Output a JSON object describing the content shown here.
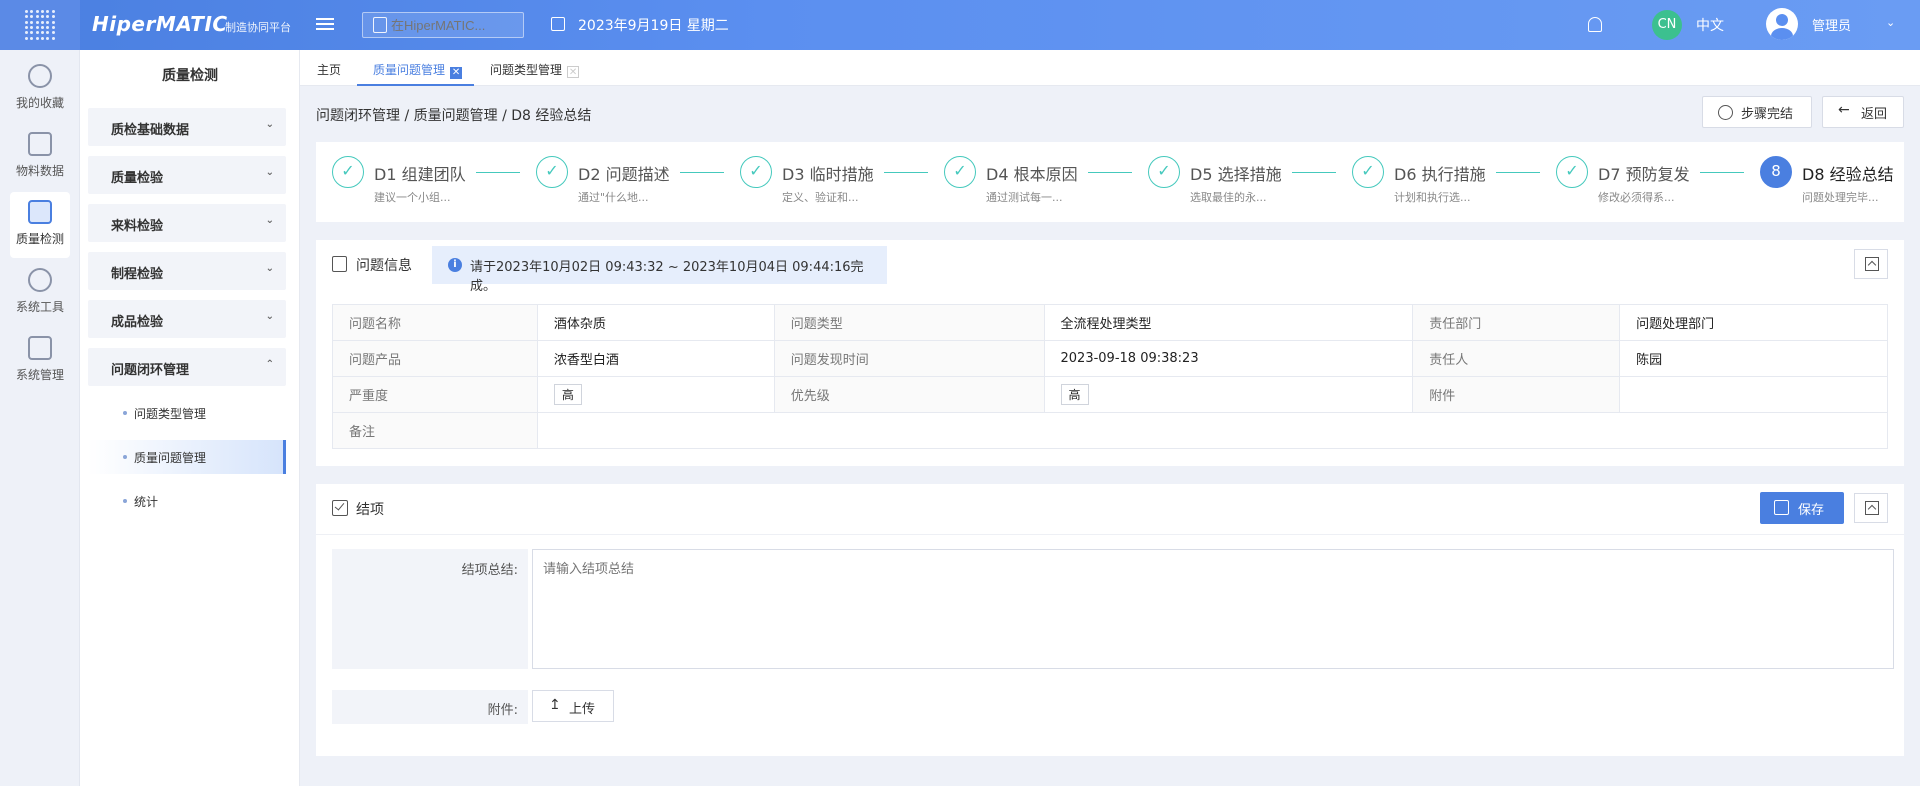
{
  "app": {
    "brand": "HiperMATIC",
    "brand_sub": "制造协同平台",
    "search_placeholder": "在HiperMATIC...",
    "date": "2023年9月19日 星期二",
    "lang_badge": "CN",
    "lang_label": "中文",
    "user_name": "管理员"
  },
  "rail": [
    {
      "label": "我的收藏",
      "icon": "star-icon"
    },
    {
      "label": "物料数据",
      "icon": "cube-icon"
    },
    {
      "label": "质量检测",
      "icon": "shield-check-icon"
    },
    {
      "label": "系统工具",
      "icon": "network-icon"
    },
    {
      "label": "系统管理",
      "icon": "settings-cube-icon"
    }
  ],
  "sidebar": {
    "title": "质量检测",
    "groups": [
      "质检基础数据",
      "质量检验",
      "来料检验",
      "制程检验",
      "成品检验",
      "问题闭环管理"
    ],
    "subitems": [
      "问题类型管理",
      "质量问题管理",
      "统计"
    ]
  },
  "tabs": [
    {
      "label": "主页"
    },
    {
      "label": "质量问题管理"
    },
    {
      "label": "问题类型管理"
    }
  ],
  "breadcrumb": "问题闭环管理 / 质量问题管理 / D8 经验总结",
  "buttons": {
    "step_complete": "步骤完结",
    "back": "返回",
    "save": "保存",
    "upload": "上传"
  },
  "steps": [
    {
      "num": "",
      "title": "D1 组建团队",
      "desc": "建议一个小组..."
    },
    {
      "num": "",
      "title": "D2 问题描述",
      "desc": "通过\"什么地..."
    },
    {
      "num": "",
      "title": "D3 临时措施",
      "desc": "定义、验证和..."
    },
    {
      "num": "",
      "title": "D4 根本原因",
      "desc": "通过测试每一..."
    },
    {
      "num": "",
      "title": "D5 选择措施",
      "desc": "选取最佳的永..."
    },
    {
      "num": "",
      "title": "D6 执行措施",
      "desc": "计划和执行选..."
    },
    {
      "num": "",
      "title": "D7 预防复发",
      "desc": "修改必须得系..."
    },
    {
      "num": "8",
      "title": "D8 经验总结",
      "desc": "问题处理完毕..."
    }
  ],
  "info": {
    "title": "问题信息",
    "notice": "请于2023年10月02日 09:43:32 ~ 2023年10月04日 09:44:16完成。",
    "rows": [
      [
        {
          "label": "问题名称",
          "value": "酒体杂质"
        },
        {
          "label": "问题类型",
          "value": "全流程处理类型"
        },
        {
          "label": "责任部门",
          "value": "问题处理部门"
        }
      ],
      [
        {
          "label": "问题产品",
          "value": "浓香型白酒"
        },
        {
          "label": "问题发现时间",
          "value": "2023-09-18 09:38:23"
        },
        {
          "label": "责任人",
          "value": "陈园"
        }
      ],
      [
        {
          "label": "严重度",
          "value": "高"
        },
        {
          "label": "优先级",
          "value": "高"
        },
        {
          "label": "附件",
          "value": ""
        }
      ],
      [
        {
          "label": "备注",
          "value": ""
        }
      ]
    ]
  },
  "closing": {
    "title": "结项",
    "summary_label": "结项总结:",
    "summary_placeholder": "请输入结项总结",
    "attachment_label": "附件:"
  },
  "colors": {
    "accent": "#4a7fe0",
    "step_done": "#45c9bd",
    "green_badge": "#3cc08f"
  }
}
